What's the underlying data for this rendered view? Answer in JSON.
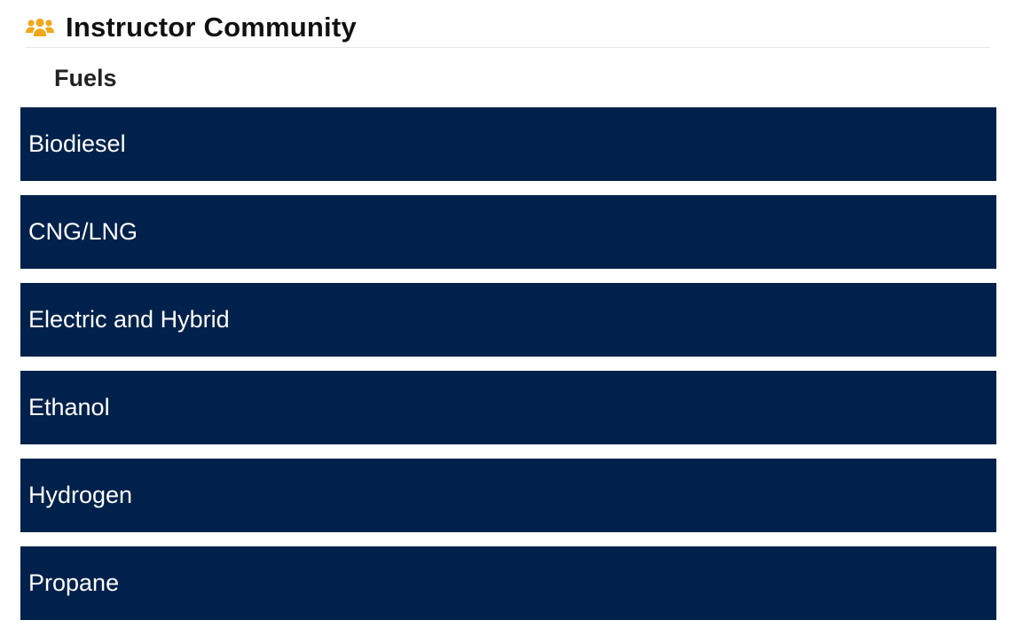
{
  "header": {
    "icon": "users-group-icon",
    "icon_color": "#f0a81a",
    "title": "Instructor Community"
  },
  "section": {
    "heading": "Fuels"
  },
  "fuels": {
    "background_color": "#00214b",
    "text_color": "#ffffff",
    "items": [
      {
        "label": "Biodiesel"
      },
      {
        "label": "CNG/LNG"
      },
      {
        "label": "Electric and Hybrid"
      },
      {
        "label": "Ethanol"
      },
      {
        "label": "Hydrogen"
      },
      {
        "label": "Propane"
      }
    ]
  }
}
